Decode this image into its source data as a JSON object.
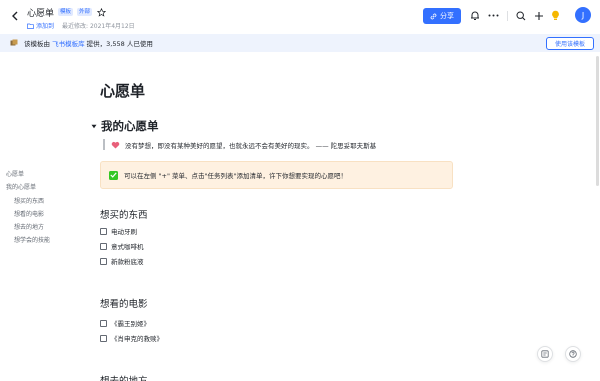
{
  "header": {
    "title": "心愿单",
    "tags": [
      "模板",
      "外部"
    ],
    "folder": "添加到",
    "modified": "最近修改: 2021年4月12日",
    "share_label": "分享",
    "avatar_letter": "J"
  },
  "banner": {
    "prefix": "该模板由",
    "link": "飞书模板库",
    "suffix": " 提供，3,558 人已使用",
    "button": "使用该模板"
  },
  "outline": {
    "items": [
      {
        "label": "心愿单"
      },
      {
        "label": "我的心愿单"
      },
      {
        "label": "想买的东西"
      },
      {
        "label": "想看的电影"
      },
      {
        "label": "想去的地方"
      },
      {
        "label": "想学会的技能"
      }
    ]
  },
  "doc": {
    "title": "心愿单",
    "heading": "我的心愿单",
    "quote": "没有梦想，即没有某种美好的愿望，也就永远不会有美好的现实。 —— 陀思妥耶夫斯基",
    "callout": "可以在左侧 \"+\" 菜单、点击\"任务列表\"添加清单，许下你想要实现的心愿吧！",
    "sections": [
      {
        "title": "想买的东西",
        "items": [
          "电动牙刷",
          "意式咖啡机",
          "新款粉底液"
        ]
      },
      {
        "title": "想看的电影",
        "items": [
          "《霸王别姬》",
          "《肖申克的救赎》"
        ]
      },
      {
        "title": "想去的地方",
        "items": []
      }
    ]
  },
  "colors": {
    "accent": "#3370ff",
    "banner_bg": "#eef3fd",
    "callout_bg": "#fef1e1",
    "heart": "#e8607a"
  }
}
